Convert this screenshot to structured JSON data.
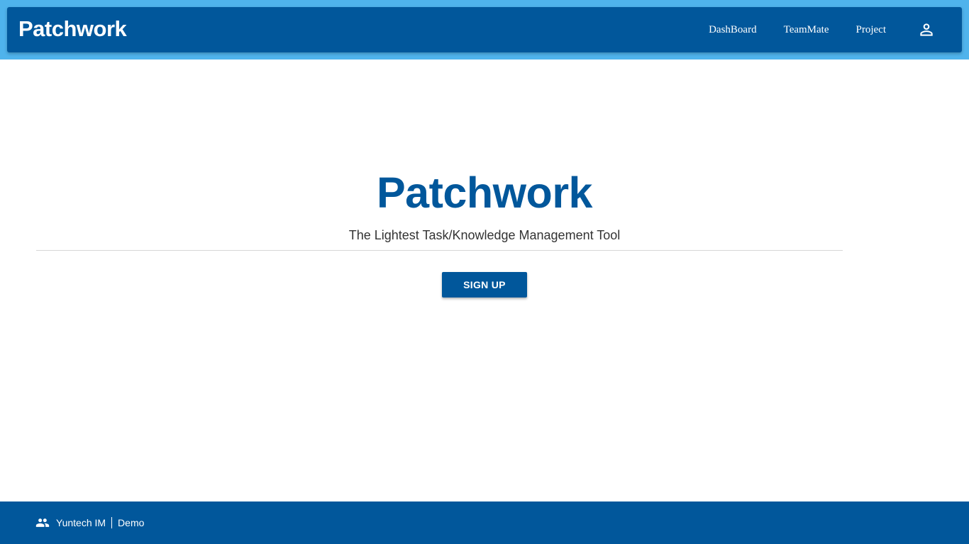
{
  "header": {
    "brand": "Patchwork",
    "nav": {
      "dashboard": "DashBoard",
      "teammate": "TeamMate",
      "project": "Project"
    },
    "user_icon": "person-icon"
  },
  "hero": {
    "title": "Patchwork",
    "subtitle": "The Lightest Task/Knowledge Management Tool",
    "signup_label": "SIGN UP"
  },
  "footer": {
    "icon": "people-icon",
    "org": "Yuntech IM",
    "env": "Demo"
  },
  "colors": {
    "primary": "#01579b",
    "header_band": "#4fb3ec",
    "background": "#ffffff"
  }
}
